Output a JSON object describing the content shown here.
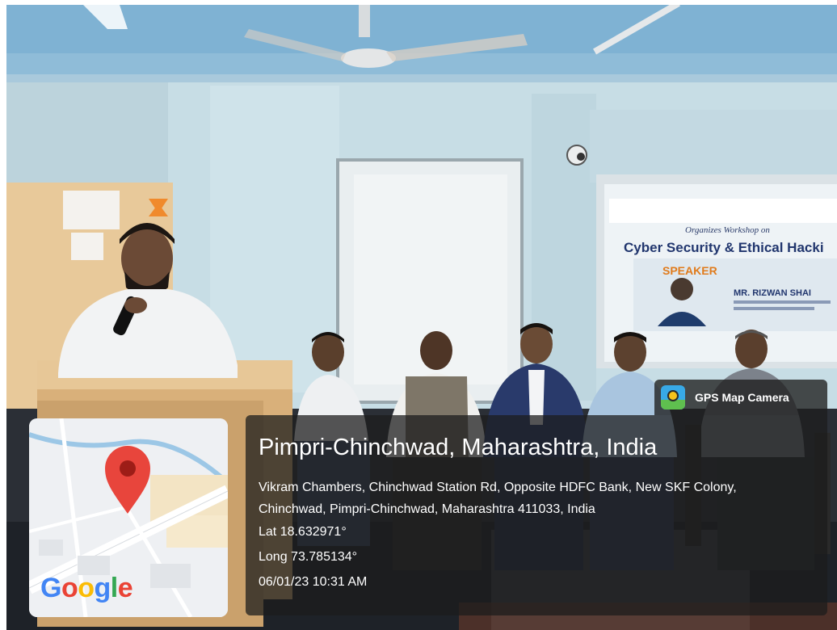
{
  "overlay": {
    "app_name": "GPS Map Camera",
    "location_title": "Pimpri-Chinchwad, Maharashtra, India",
    "address": "Vikram Chambers, Chinchwad Station Rd, Opposite HDFC Bank, New SKF Colony, Chinchwad, Pimpri-Chinchwad, Maharashtra 411033, India",
    "latitude": "Lat 18.632971°",
    "longitude": "Long 73.785134°",
    "timestamp": "06/01/23 10:31 AM"
  },
  "map": {
    "logo_letters": [
      "G",
      "o",
      "o",
      "g",
      "l",
      "e"
    ],
    "logo_colors": [
      "#4285f4",
      "#ea4335",
      "#fbbc05",
      "#4285f4",
      "#34a853",
      "#ea4335"
    ],
    "pin_color": "#e8453c"
  },
  "projection": {
    "heading": "Cyber Security & Ethical Hacki",
    "subheading": "Organizes Workshop on",
    "speaker_label": "SPEAKER",
    "speaker_name": "MR. RIZWAN SHAI"
  }
}
